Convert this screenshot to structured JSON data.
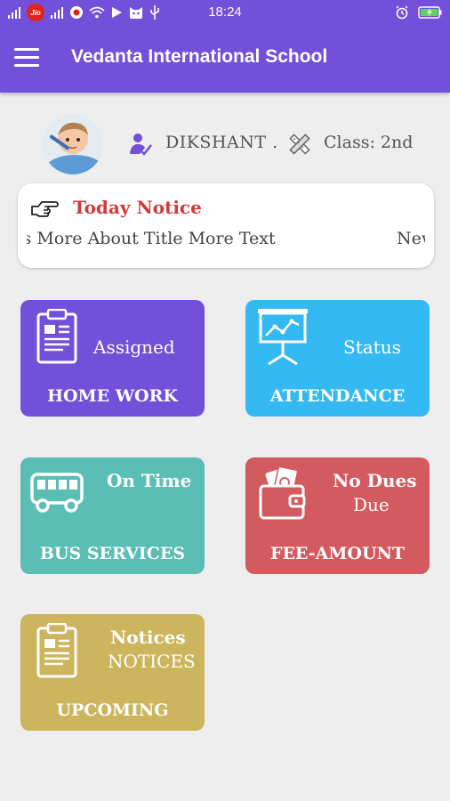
{
  "status_bar": {
    "time": "18:24",
    "carrier": "Jio"
  },
  "app_bar": {
    "title": "Vedanta International School"
  },
  "profile": {
    "student_name": "DIKSHANT .",
    "class_label": "Class: 2nd"
  },
  "notice": {
    "title": "Today Notice",
    "ticker_text": "Title Texts More About Title More Text",
    "ticker_next": "New"
  },
  "tiles": {
    "homework": {
      "status": "Assigned",
      "title": "HOME WORK",
      "icon": "clipboard-icon"
    },
    "attendance": {
      "status": "Status",
      "title": "ATTENDANCE",
      "icon": "presentation-chart-icon"
    },
    "bus": {
      "status": "On Time",
      "title": "BUS SERVICES",
      "icon": "bus-icon"
    },
    "fee": {
      "status": "No Dues",
      "status2": "Due",
      "title": "FEE-AMOUNT",
      "icon": "wallet-icon"
    },
    "upcoming": {
      "status": "Notices",
      "status2": "NOTICES",
      "title": "UPCOMING",
      "icon": "clipboard-icon"
    }
  },
  "colors": {
    "primary": "#7250d9",
    "attendance": "#35b9f2",
    "bus": "#5bbeb4",
    "fee": "#d35a5f",
    "upcoming": "#cdb55e",
    "notice_title": "#d03a3a"
  }
}
